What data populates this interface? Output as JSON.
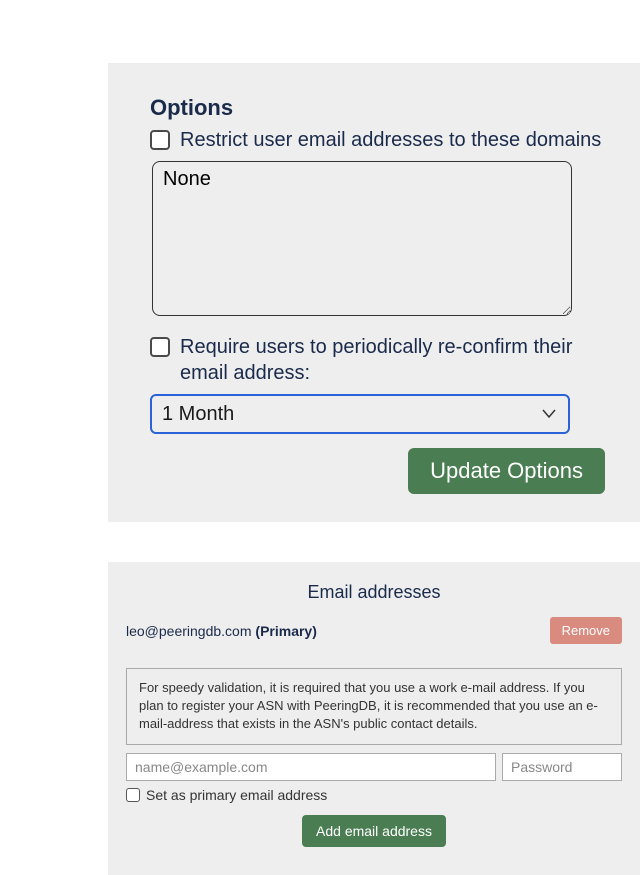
{
  "options": {
    "title": "Options",
    "restrict": {
      "checked": false,
      "label": "Restrict user email addresses to these domains",
      "textarea_value": "None"
    },
    "reconfirm": {
      "checked": false,
      "label": "Require users to periodically re-confirm their email address:",
      "selected": "1 Month"
    },
    "update_label": "Update Options"
  },
  "emails": {
    "title": "Email addresses",
    "list": [
      {
        "address": "leo@peeringdb.com",
        "primary_label": "(Primary)",
        "remove_label": "Remove"
      }
    ],
    "info_text": "For speedy validation, it is required that you use a work e-mail address. If you plan to register your ASN with PeeringDB, it is recommended that you use an e-mail-address that exists in the ASN's public contact details.",
    "email_placeholder": "name@example.com",
    "password_placeholder": "Password",
    "set_primary_label": "Set as primary email address",
    "add_label": "Add email address"
  }
}
